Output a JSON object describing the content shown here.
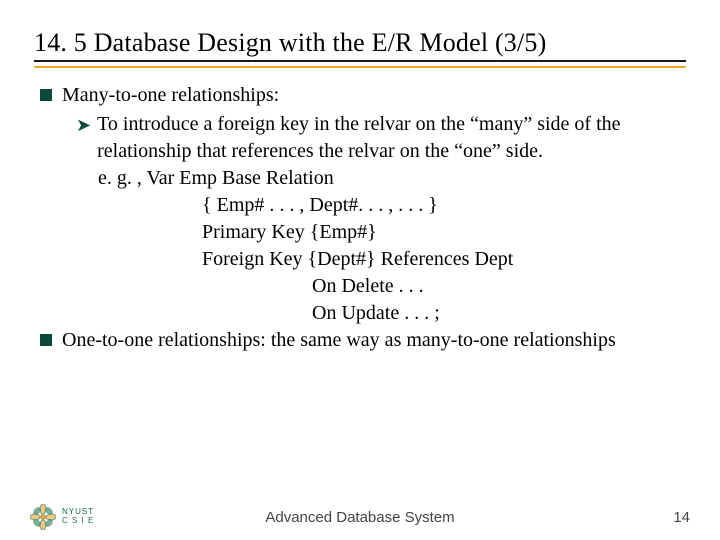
{
  "title": "14. 5   Database Design with the E/R Model (3/5)",
  "bullets": [
    {
      "text": "Many-to-one relationships:",
      "sub": {
        "text": "To introduce a foreign key in the relvar on the “many” side of the relationship that references the relvar on the “one” side."
      },
      "lines_a": [
        "e. g. , Var Emp Base Relation"
      ],
      "lines_b": [
        "{ Emp# . . . , Dept#. . . , . . . }",
        "Primary Key {Emp#}",
        "Foreign Key {Dept#} References Dept"
      ],
      "lines_c": [
        "On Delete . . .",
        "On Update . . . ;"
      ]
    },
    {
      "text": "One-to-one relationships: the same way as many-to-one relationships"
    }
  ],
  "footer": {
    "logo_top": "NYUST",
    "logo_bottom": "C S I E",
    "center": "Advanced Database System",
    "page": "14"
  }
}
